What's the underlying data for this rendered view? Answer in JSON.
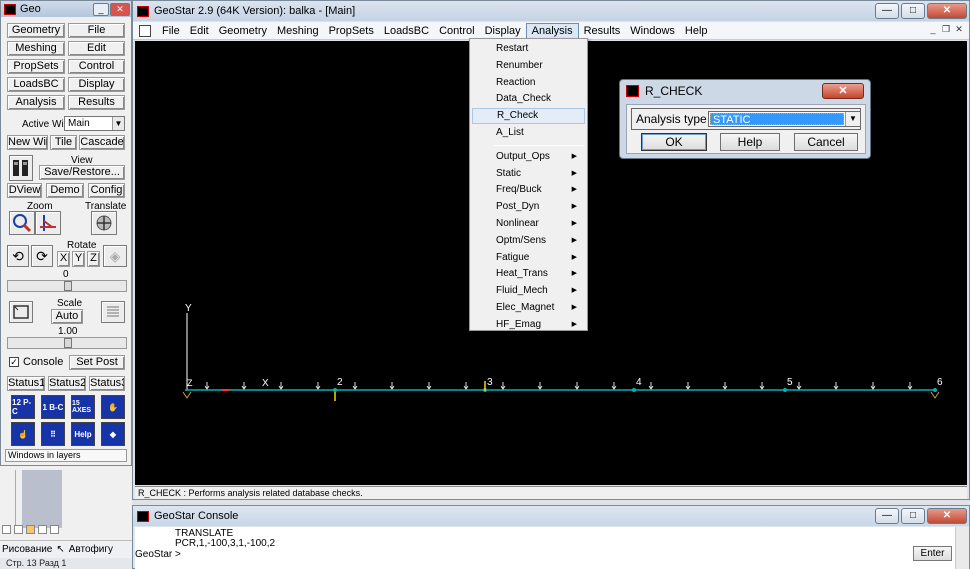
{
  "geo_panel": {
    "title": "Geo",
    "menu_buttons": [
      "Geometry",
      "File",
      "Meshing",
      "Edit",
      "PropSets",
      "Control",
      "LoadsBC",
      "Display",
      "Analysis",
      "Results"
    ],
    "active_win_label": "Active Win",
    "active_win_value": "Main",
    "window_buttons": [
      "New Win",
      "Tile",
      "Cascade"
    ],
    "view_label": "View",
    "save_restore_label": "Save/Restore...",
    "view_buttons": [
      "DView",
      "Demo",
      "Config"
    ],
    "zoom_label": "Zoom",
    "translate_label": "Translate",
    "rotate_label": "Rotate",
    "rotate_axes": [
      "X",
      "Y",
      "Z"
    ],
    "rotate_value": "0",
    "scale_label": "Scale",
    "scale_auto_label": "Auto",
    "scale_value": "1.00",
    "console_checkbox_label": "Console",
    "console_checked": true,
    "set_post_label": "Set Post",
    "status_buttons": [
      "Status1",
      "Status2",
      "Status3"
    ],
    "icon_grid": [
      {
        "name": "pc-count-icon",
        "text": "12 P-C"
      },
      {
        "name": "bc-count-icon",
        "text": "1 B-C"
      },
      {
        "name": "axes-count-icon",
        "text": "15 AXES"
      },
      {
        "name": "hand-tool-icon",
        "text": ""
      },
      {
        "name": "hand-pointer-icon",
        "text": ""
      },
      {
        "name": "grid-dots-icon",
        "text": ""
      },
      {
        "name": "help-icon",
        "text": "Help"
      },
      {
        "name": "geostar-logo-icon",
        "text": ""
      }
    ],
    "windows_in_layers_label": "Windows in layers"
  },
  "background_app": {
    "toolbar_label": "Рисование",
    "autoshapes_label": "Автофигу",
    "status_line": "Стр.   13       Разд   1"
  },
  "main_window": {
    "title": "GeoStar 2.9 (64K Version): balka - [Main]",
    "menu": [
      "File",
      "Edit",
      "Geometry",
      "Meshing",
      "PropSets",
      "LoadsBC",
      "Control",
      "Display",
      "Analysis",
      "Results",
      "Windows",
      "Help"
    ],
    "active_menu": "Analysis",
    "status_text": "R_CHECK : Performs analysis related database checks."
  },
  "analysis_menu": {
    "group1": [
      "Restart",
      "Renumber",
      "Reaction",
      "Data_Check",
      "R_Check",
      "A_List"
    ],
    "group2": [
      "Output_Ops",
      "Static",
      "Freq/Buck",
      "Post_Dyn",
      "Nonlinear",
      "Optm/Sens",
      "Fatigue",
      "Heat_Trans",
      "Fluid_Mech",
      "Elec_Magnet",
      "HF_Emag"
    ],
    "highlighted": "R_Check"
  },
  "rcheck_dialog": {
    "title": "R_CHECK",
    "field_label": "Analysis type",
    "field_value": "STATIC",
    "buttons": [
      "OK",
      "Help",
      "Cancel"
    ]
  },
  "canvas": {
    "background": "#000000",
    "beam_color": "#00b4b4",
    "node_labels": [
      "2",
      "3",
      "4",
      "5",
      "6"
    ],
    "axis_labels": {
      "x": "X",
      "y": "Y",
      "z": "Z"
    }
  },
  "console": {
    "title": "GeoStar Console",
    "lines": [
      "TRANSLATE",
      "PCR,1,-100,3,1,-100,2"
    ],
    "prompt": "GeoStar >",
    "enter_label": "Enter"
  }
}
